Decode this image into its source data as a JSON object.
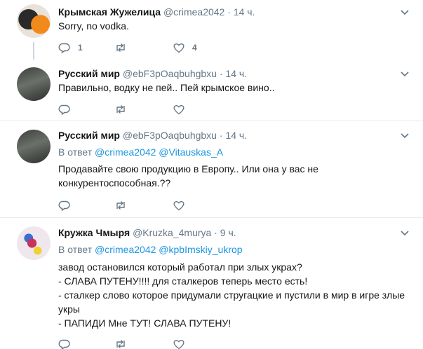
{
  "tweets": [
    {
      "name": "Крымская Жужелица",
      "handle": "@crimea2042",
      "time": "· 14 ч.",
      "reply_prefix": "",
      "reply_users": [],
      "lines": [
        "Sorry, no vodka."
      ],
      "counts": {
        "reply": "1",
        "retweet": "",
        "like": "4"
      }
    },
    {
      "name": "Русский мир",
      "handle": "@ebF3pOaqbuhgbxu",
      "time": "· 14 ч.",
      "reply_prefix": "",
      "reply_users": [],
      "lines": [
        "Правильно, водку не пей.. Пей крымское вино.."
      ],
      "counts": {
        "reply": "",
        "retweet": "",
        "like": ""
      }
    },
    {
      "name": "Русский мир",
      "handle": "@ebF3pOaqbuhgbxu",
      "time": "· 14 ч.",
      "reply_prefix": "В ответ",
      "reply_users": [
        "@crimea2042",
        "@Vitauskas_A"
      ],
      "lines": [
        "Продавайте свою продукцию в Европу.. Или она у вас не",
        "конкурентоспособная.??"
      ],
      "counts": {
        "reply": "",
        "retweet": "",
        "like": ""
      }
    },
    {
      "name": "Кружка Чмыря",
      "handle": "@Kruzka_4murya",
      "time": "· 9 ч.",
      "reply_prefix": "В ответ",
      "reply_users": [
        "@crimea2042",
        "@kpbImskiy_ukrop"
      ],
      "lines": [
        "завод остановился который работал при злых украх?",
        "- СЛАВА ПУТЕНУ!!!! для сталкеров теперь место есть!",
        "- сталкер слово которое придумали стругацкие и пустили в мир в игре злые",
        "укры",
        "- ПАПИДИ Мне ТУТ! СЛАВА ПУТЕНУ!"
      ],
      "counts": {
        "reply": "",
        "retweet": "",
        "like": ""
      }
    }
  ],
  "icons": {
    "reply": "reply-icon",
    "retweet": "retweet-icon",
    "like": "heart-icon",
    "caret": "chevron-down-icon"
  },
  "colors": {
    "name": "#14171a",
    "secondary": "#657786",
    "link": "#1b95e0",
    "divider": "#e6ecf0",
    "thread_line": "#ccd6dd"
  }
}
